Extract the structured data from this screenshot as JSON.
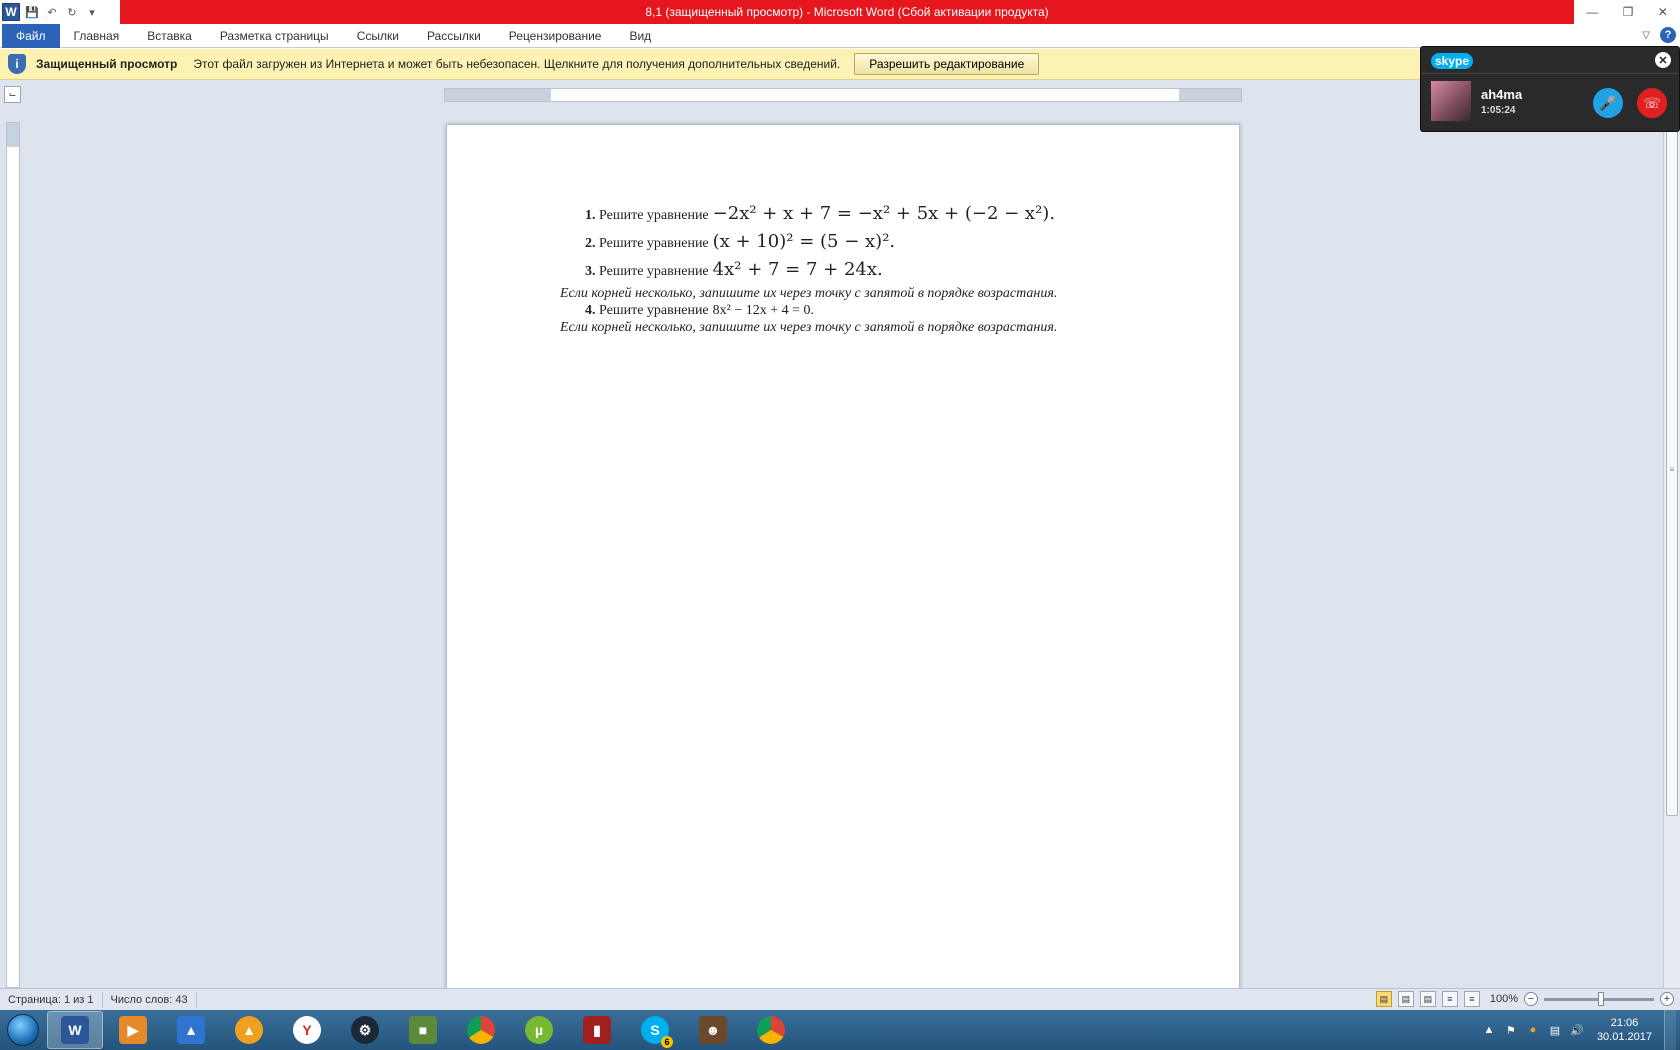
{
  "titlebar": {
    "title": "8,1 (защищенный просмотр) - Microsoft Word (Сбой активации продукта)",
    "app_icon": "W"
  },
  "ribbon": {
    "tabs": [
      "Файл",
      "Главная",
      "Вставка",
      "Разметка страницы",
      "Ссылки",
      "Рассылки",
      "Рецензирование",
      "Вид"
    ]
  },
  "message_bar": {
    "title": "Защищенный просмотр",
    "text": "Этот файл загружен из Интернета и может быть небезопасен. Щелкните для получения дополнительных сведений.",
    "button": "Разрешить редактирование"
  },
  "document": {
    "tasks": [
      {
        "num": "1.",
        "label": "Решите уравнение",
        "equation": "−2x² + x + 7 = −x² + 5x + (−2 − x²)."
      },
      {
        "num": "2.",
        "label": "Решите уравнение",
        "equation": "(x + 10)² = (5 − x)²."
      },
      {
        "num": "3.",
        "label": "Решите уравнение",
        "equation": "4x² + 7 = 7 + 24x."
      },
      {
        "num": "4.",
        "label": "Решите уравнение",
        "equation": "8x² − 12x + 4 = 0."
      }
    ],
    "note": "Если корней несколько, запишите их через точку с запятой в порядке возрастания."
  },
  "skype": {
    "logo": "skype",
    "contact": "ah4ma",
    "duration": "1:05:24"
  },
  "statusbar": {
    "page": "Страница: 1 из 1",
    "words": "Число слов: 43",
    "zoom": "100%"
  },
  "taskbar": {
    "time": "21:06",
    "date": "30.01.2017",
    "skype_badge": "6"
  },
  "colors": {
    "title_red": "#e5171d",
    "file_tab": "#2b63b8",
    "message_bar": "#fcf2b3",
    "workspace": "#dde4ee"
  }
}
